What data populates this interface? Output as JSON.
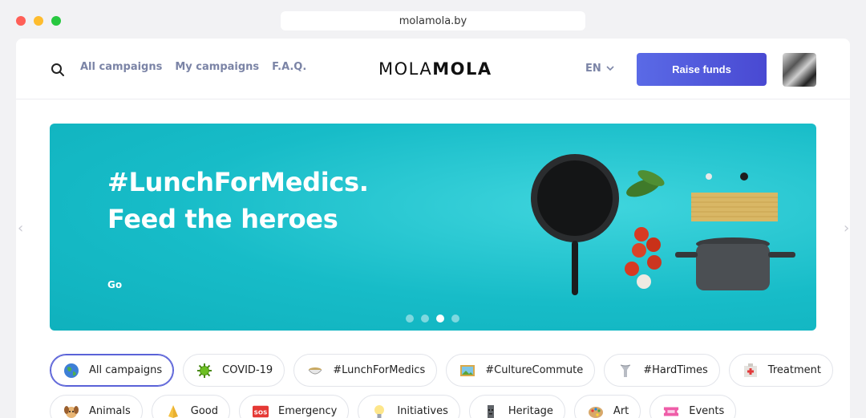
{
  "browser": {
    "url": "molamola.by"
  },
  "header": {
    "nav": [
      "All campaigns",
      "My campaigns",
      "F.A.Q."
    ],
    "logo": {
      "light": "MOLA",
      "bold": "MOLA"
    },
    "language": "EN",
    "raise_funds_label": "Raise funds"
  },
  "hero": {
    "title_line1": "#LunchForMedics.",
    "title_line2": "Feed the heroes",
    "cta": "Go",
    "slides_total": 4,
    "active_slide": 3
  },
  "categories": {
    "row1": [
      {
        "label": "All campaigns",
        "icon": "globe-icon",
        "active": true
      },
      {
        "label": "COVID-19",
        "icon": "virus-icon"
      },
      {
        "label": "#LunchForMedics",
        "icon": "bowl-icon"
      },
      {
        "label": "#CultureCommute",
        "icon": "framed-picture-icon"
      },
      {
        "label": "#HardTimes",
        "icon": "hardtimes-icon"
      },
      {
        "label": "Treatment",
        "icon": "hospital-icon"
      }
    ],
    "row2": [
      {
        "label": "Animals",
        "icon": "dog-icon"
      },
      {
        "label": "Good",
        "icon": "praying-hands-icon"
      },
      {
        "label": "Emergency",
        "icon": "sos-icon"
      },
      {
        "label": "Initiatives",
        "icon": "light-bulb-icon"
      },
      {
        "label": "Heritage",
        "icon": "moai-icon"
      },
      {
        "label": "Art",
        "icon": "palette-icon"
      },
      {
        "label": "Events",
        "icon": "ticket-icon"
      }
    ]
  },
  "colors": {
    "accent": "#5a62d8",
    "hero_bg": "#17bcc8",
    "nav_text": "#7b84a6"
  }
}
